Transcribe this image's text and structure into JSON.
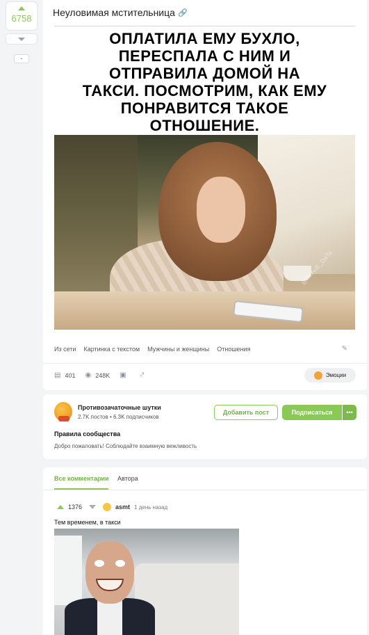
{
  "vote": {
    "rating": "6758",
    "minus_label": "-"
  },
  "post": {
    "title": "Неуловимая мстительница",
    "meme_lines": [
      "ОПЛАТИЛА ЕМУ БУХЛО,",
      "ПЕРЕСПАЛА С НИМ И",
      "ОТПРАВИЛА ДОМОЙ НА",
      "ТАКСИ. ПОСМОТРИМ, КАК ЕМУ",
      "ПОНРАВИТСЯ ТАКОЕ",
      "ОТНОШЕНИЕ."
    ],
    "watermark": "@PeAcE_DaTa",
    "tags": [
      "Из сети",
      "Картинка с текстом",
      "Мужчины и женщины",
      "Отношения"
    ],
    "comments_count": "401",
    "views_count": "248K",
    "emotions_label": "Эмоции"
  },
  "community": {
    "name": "Противозачаточные шутки",
    "stats": "2.7K постов • 6.3K подписчиков",
    "add_post_label": "Добавить пост",
    "subscribe_label": "Подписаться",
    "more_label": "•••",
    "rules_title": "Правила сообщества",
    "rules_text": "Добро пожаловать! Соблюдайте взаимную вежливость"
  },
  "comments": {
    "tabs": [
      "Все комментарии",
      "Автора"
    ],
    "items": [
      {
        "rating": "1376",
        "user": "asmt",
        "time": "1 день назад",
        "text": "Тем временем, в такси"
      }
    ]
  },
  "colors": {
    "accent": "#8ac858",
    "background": "#f2f4f5"
  },
  "icons": {
    "link": "link-icon",
    "edit": "pencil-icon",
    "comments": "comment-icon",
    "views": "eye-icon",
    "save": "save-icon",
    "share": "share-icon"
  }
}
